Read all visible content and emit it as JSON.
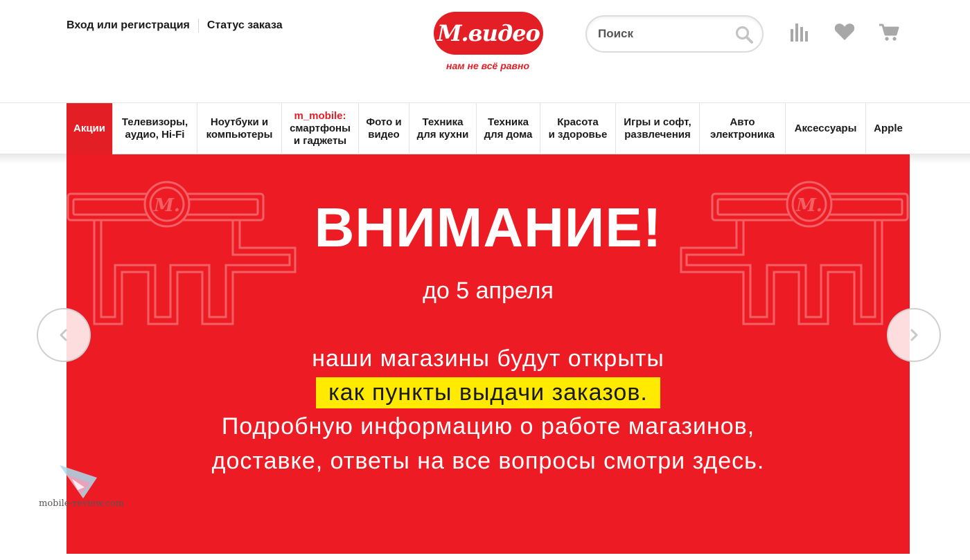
{
  "header": {
    "login_label": "Вход или регистрация",
    "order_status_label": "Статус заказа",
    "logo_text": "М.видео",
    "slogan": "нам не всё равно",
    "search_placeholder": "Поиск",
    "icons": [
      "compare-icon",
      "heart-icon",
      "cart-icon"
    ]
  },
  "nav": {
    "items": [
      {
        "label": "Акции",
        "active": true
      },
      {
        "label": "Телевизоры,\nаудио, Hi-Fi"
      },
      {
        "label": "Ноутбуки и\nкомпьютеры"
      },
      {
        "label_red": "m_mobile:",
        "label": "смартфоны\nи гаджеты"
      },
      {
        "label": "Фото и\nвидео"
      },
      {
        "label": "Техника\nдля кухни"
      },
      {
        "label": "Техника\nдля дома"
      },
      {
        "label": "Красота\nи здоровье"
      },
      {
        "label": "Игры и софт,\nразвлечения"
      },
      {
        "label": "Авто\nэлектроника"
      },
      {
        "label": "Аксессуары"
      },
      {
        "label": "Apple"
      }
    ]
  },
  "banner": {
    "title": "ВНИМАНИЕ!",
    "date": "до 5 апреля",
    "line1": "наши магазины будут открыты",
    "highlight": "как пункты выдачи заказов.",
    "line3": "Подробную информацию о работе магазинов,",
    "line4": "доставке, ответы на все вопросы смотри здесь."
  },
  "watermark": {
    "text": "mobile-review.com"
  },
  "colors": {
    "brand_red": "#e31e24",
    "banner_red": "#ed1c24",
    "highlight_yellow": "#ffea00"
  }
}
